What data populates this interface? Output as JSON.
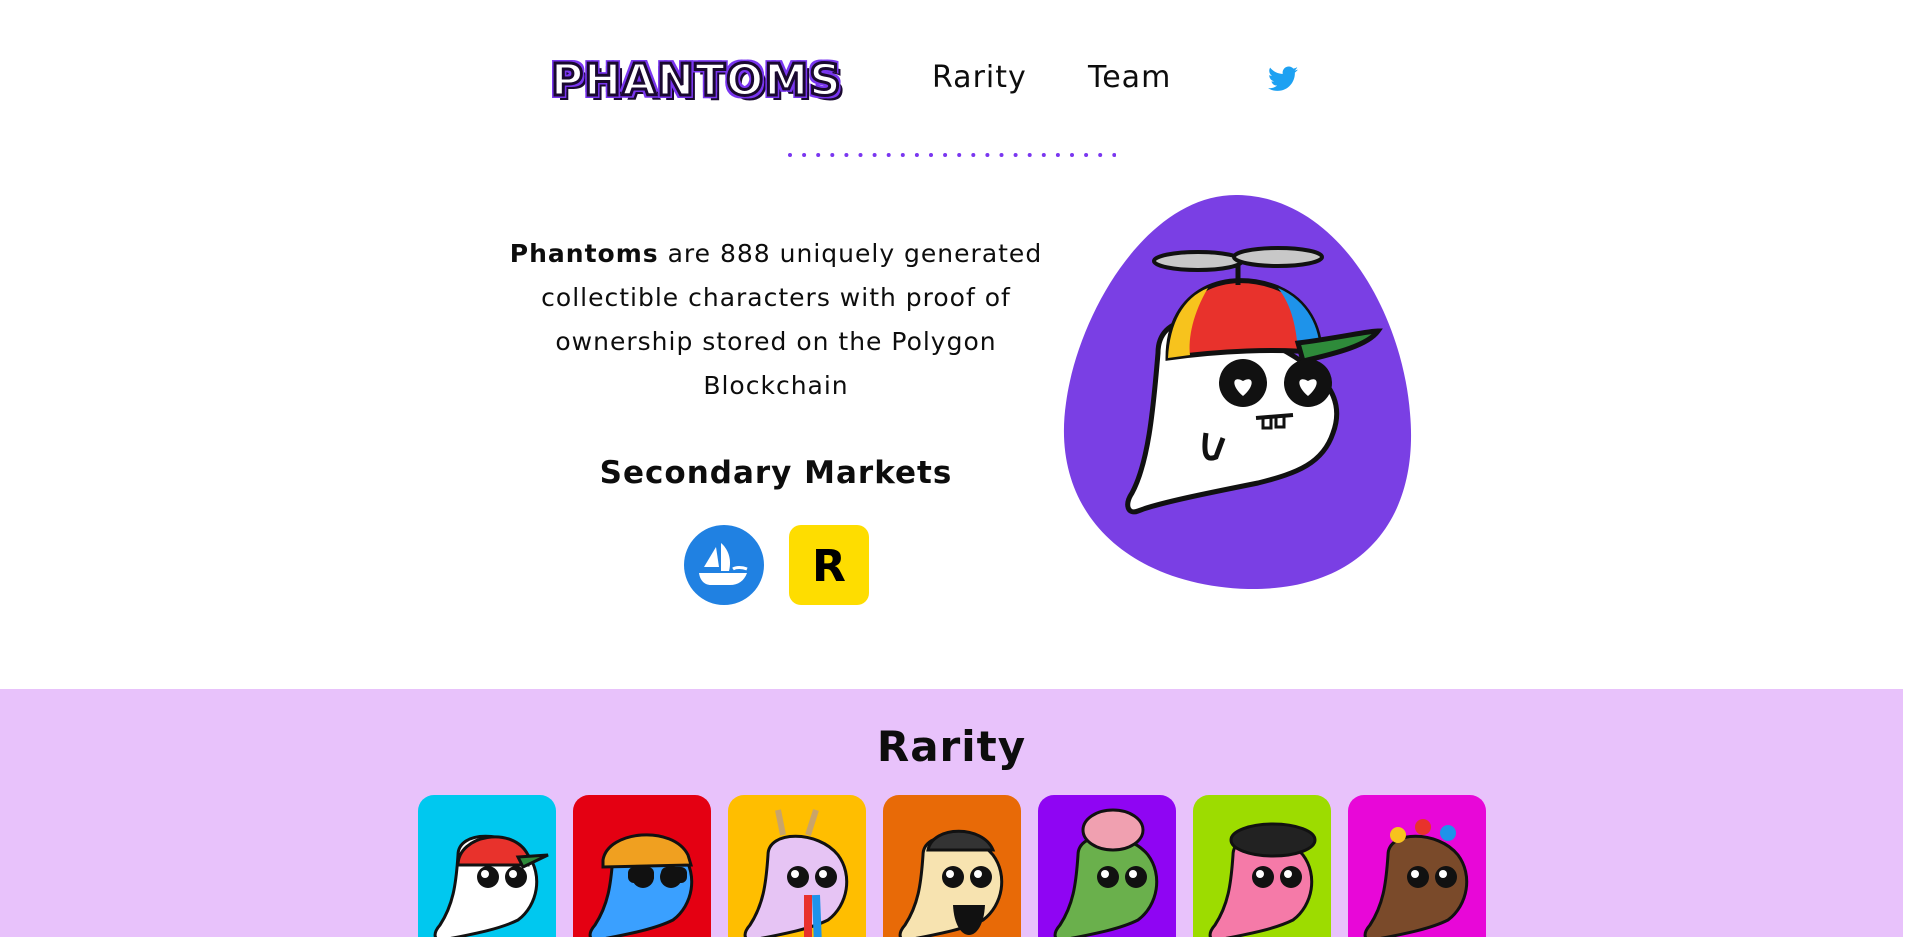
{
  "header": {
    "logo_text": "PHANTOMS",
    "nav": [
      {
        "label": "Rarity"
      },
      {
        "label": "Team"
      }
    ],
    "twitter_icon": "twitter-bird-icon"
  },
  "hero": {
    "brand": "Phantoms",
    "description_rest": " are 888 uniquely generated collectible characters with proof of ownership stored on the Polygon Blockchain",
    "markets_title": "Secondary Markets",
    "markets": [
      {
        "name": "opensea",
        "icon": "opensea-ship-icon",
        "color": "#2081e2"
      },
      {
        "name": "rarible",
        "icon": "rarible-r-icon",
        "color": "#fedd00",
        "letter": "R"
      }
    ],
    "blob_color": "#7a3fe4"
  },
  "rarity": {
    "title": "Rarity",
    "band_color": "#e8c2fb",
    "cards": [
      {
        "color": "#00c8ef",
        "character": "propeller-cap-phantom"
      },
      {
        "color": "#e40012",
        "character": "bandana-sunglasses-phantom"
      },
      {
        "color": "#ffbe00",
        "character": "antler-rainbow-phantom"
      },
      {
        "color": "#e86a07",
        "character": "bearded-goggles-phantom"
      },
      {
        "color": "#8f05f3",
        "character": "zombie-brain-phantom"
      },
      {
        "color": "#9ddc00",
        "character": "beret-painter-phantom"
      },
      {
        "color": "#e807d8",
        "character": "flower-crown-phantom"
      }
    ]
  },
  "colors": {
    "accent": "#7a36f0",
    "text": "#0d0d0d"
  }
}
